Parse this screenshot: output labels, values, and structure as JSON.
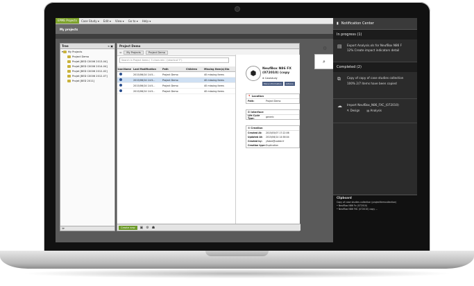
{
  "menubar": {
    "app_button": "EPME Projects",
    "menus": [
      "Case Study ▾",
      "Edit ▾",
      "View ▾",
      "Go to ▾",
      "Help ▾"
    ]
  },
  "header": {
    "title": "My projects"
  },
  "tree": {
    "title": "Tree",
    "items": [
      "My Projects",
      "Project Demo",
      "Projet [BED C0006 2013-04]",
      "Projet [BED C0006 2014-04]",
      "Projet [BED C0006 2012-02]",
      "Projet [BED C0006 2012-07]",
      "Projet [BED 2011]"
    ],
    "footer": "≫"
  },
  "main": {
    "title": "Project Demo",
    "crumbs": [
      "My Projects",
      "Project Demo"
    ],
    "search_placeholder": "Search in Project items ( 3 chars min ) (shortcut 'F')",
    "columns": [
      "Icon",
      "Name",
      "Last Modification",
      "Path",
      "Children",
      "Missing Item(s)",
      "Sta"
    ],
    "rows": [
      {
        "date": "2015/06/14 14:5...",
        "path": "Project Demo",
        "missing": "40 missing items"
      },
      {
        "date": "2015/06/14 14:5...",
        "path": "Project Demo",
        "missing": "40 missing items"
      },
      {
        "date": "2015/06/14 14:5...",
        "path": "Project Demo",
        "missing": "40 missing items"
      },
      {
        "date": "2015/06/14 14:5...",
        "path": "Project Demo",
        "missing": "40 missing items"
      }
    ],
    "create_button": "Create new"
  },
  "details": {
    "title_line1": "NeufBox N86 FX",
    "title_line2": "(072010) (copy",
    "workspace": "Casestudy",
    "tags": [
      "More information",
      "Actions"
    ],
    "location": {
      "title": "Location",
      "path_label": "Path:",
      "path_value": "Project Demo"
    },
    "interface": {
      "title": "Interface",
      "lifecycle_label": "Life Cycle Type:",
      "lifecycle_value": "generic"
    },
    "creation": {
      "title": "Creation",
      "created_at_label": "Created At:",
      "created_at": "2015/05/07 17:22:06",
      "updated_at_label": "Updated At:",
      "updated_at": "2015/06/14 14:58:04",
      "created_by_label": "Created by:",
      "created_by": "yfabre@codde.fr",
      "creation_type_label": "Creation type:",
      "creation_type": "Duplication"
    }
  },
  "notification": {
    "title": "Notification Center",
    "in_progress": "In progress (1)",
    "progress_line1": "Export Analysis.xls for NeufBox N86 F",
    "progress_line2": "12% Create impact indicators detail",
    "completed": "Completed (2)",
    "copy_line1": "Copy of copy of case studies collection",
    "copy_line2": "100% 2/7 items have been copied",
    "import_line1": "Import NeufBox_N86_FXC_(072010)",
    "link_design": "Design",
    "link_analysis": "Analysis",
    "clipboard_title": "Clipboard",
    "clipboard_lines": [
      "Copy of case studies collection (projectItemcollection)",
      "• NeufBox N86 Fx (072010)",
      "• NeufBox N86 FXC (072010) copy ..."
    ]
  }
}
